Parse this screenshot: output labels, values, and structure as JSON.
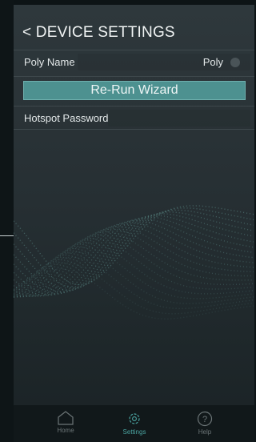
{
  "header": {
    "title": "< DEVICE SETTINGS"
  },
  "settings": {
    "poly_name_label": "Poly Name",
    "poly_name_value": "Poly",
    "wizard_button": "Re-Run Wizard",
    "hotspot_label": "Hotspot Password"
  },
  "tabs": [
    {
      "label": "Home",
      "icon": "home-icon"
    },
    {
      "label": "Settings",
      "icon": "gear-icon",
      "active": true
    },
    {
      "label": "Help",
      "icon": "question-icon"
    }
  ],
  "colors": {
    "accent": "#4d9190",
    "active_tab": "#4aa3a0",
    "inactive_tab": "#6c7577"
  }
}
